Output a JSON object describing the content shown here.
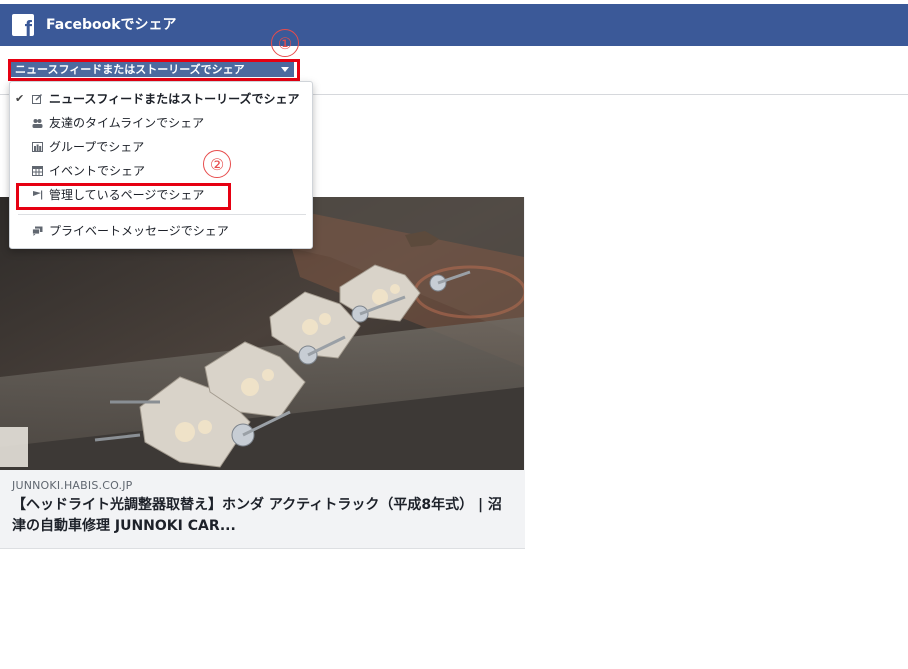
{
  "header": {
    "logo_icon": "facebook-f-icon",
    "title": "Facebookでシェア",
    "color": "#3b5998"
  },
  "share_target": {
    "selected_label": "ニュースフィードまたはストーリーズでシェア",
    "caret_icon": "caret-down-icon"
  },
  "annotations": {
    "step1": "①",
    "step2": "②",
    "highlight_color": "#e60012"
  },
  "menu": {
    "items": [
      {
        "label": "ニュースフィードまたはストーリーズでシェア",
        "icon": "edit-icon",
        "selected": true,
        "check": "✔"
      },
      {
        "label": "友達のタイムラインでシェア",
        "icon": "friends-icon",
        "selected": false
      },
      {
        "label": "グループでシェア",
        "icon": "group-icon",
        "selected": false
      },
      {
        "label": "イベントでシェア",
        "icon": "calendar-icon",
        "selected": false
      },
      {
        "label": "管理しているページでシェア",
        "icon": "flag-icon",
        "selected": false
      },
      {
        "label": "プライベートメッセージでシェア",
        "icon": "message-icon",
        "selected": false
      }
    ]
  },
  "preview": {
    "domain": "JUNNOKI.HABIS.CO.JP",
    "title": "【ヘッドライト光調整器取替え】ホンダ アクティトラック（平成8年式） | 沼津の自動車修理 JUNNOKI CAR..."
  }
}
